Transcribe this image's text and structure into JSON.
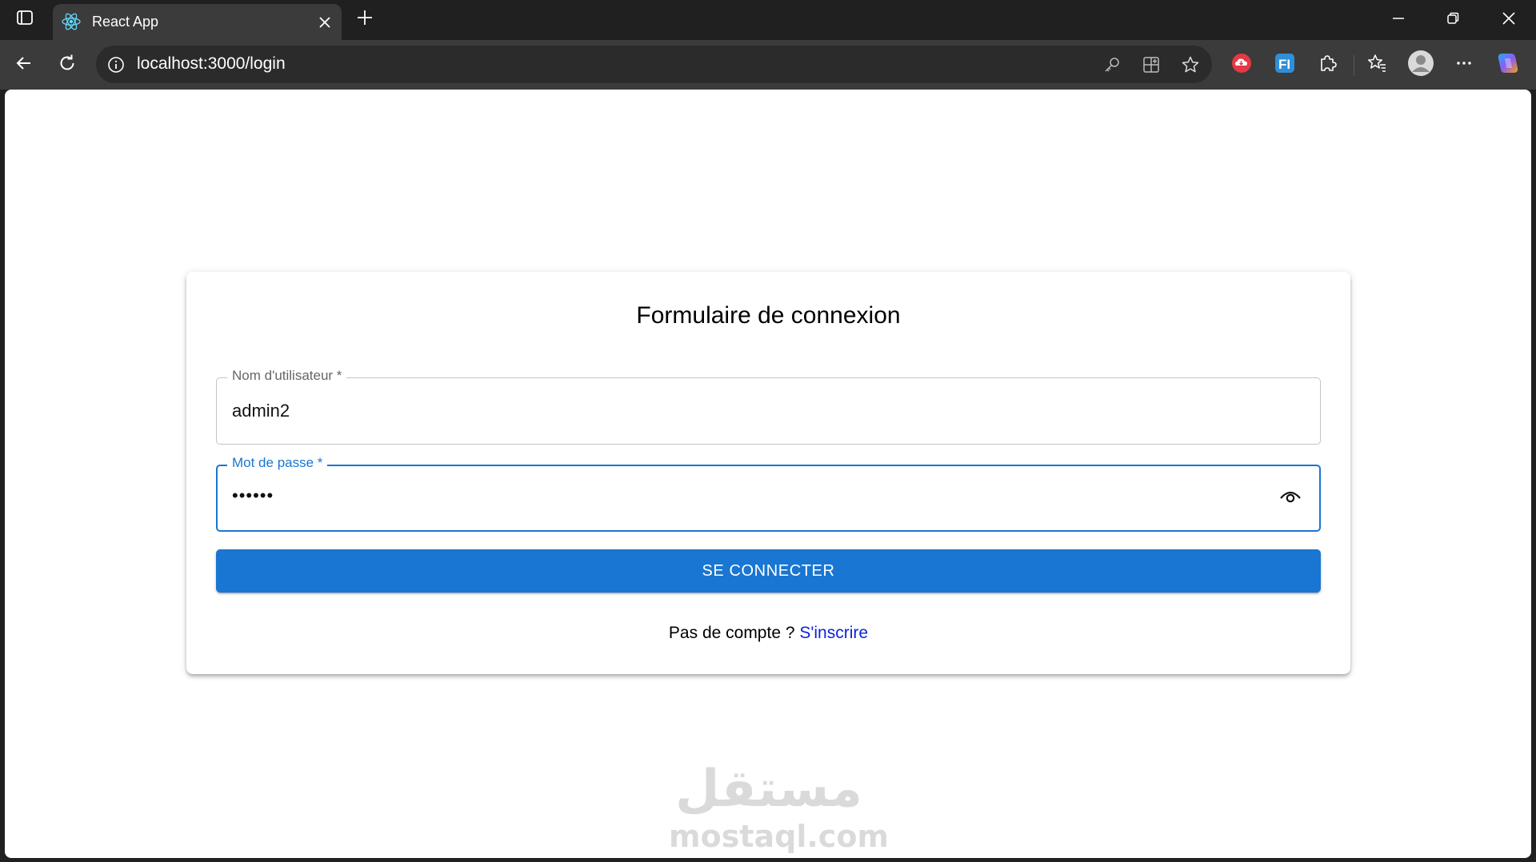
{
  "browser": {
    "tab": {
      "title": "React App",
      "favicon": "react-logo"
    },
    "toolbar": {
      "url": "localhost:3000/login",
      "icons": [
        "back-icon",
        "reload-icon",
        "info-icon",
        "key-icon",
        "app-available-icon",
        "favorite-star-icon",
        "cloud-extension-icon",
        "fi-extension-icon",
        "extensions-puzzle-icon",
        "favorites-icon",
        "profile-avatar-icon",
        "more-icon",
        "copilot-icon"
      ]
    },
    "colors": {
      "frame": "#202020",
      "toolbar": "#3b3b3b",
      "omnibox": "#2b2b2b"
    }
  },
  "login": {
    "title": "Formulaire de connexion",
    "username": {
      "label": "Nom d'utilisateur *",
      "value": "admin2"
    },
    "password": {
      "label": "Mot de passe *",
      "masked_value": "••••••"
    },
    "submit_label": "SE CONNECTER",
    "signup_prompt": "Pas de compte ? ",
    "signup_link": "S'inscrire",
    "colors": {
      "primary": "#1976d2",
      "link": "#0b24d6"
    }
  },
  "watermark": {
    "arabic": "مستقل",
    "latin": "mostaql.com"
  }
}
